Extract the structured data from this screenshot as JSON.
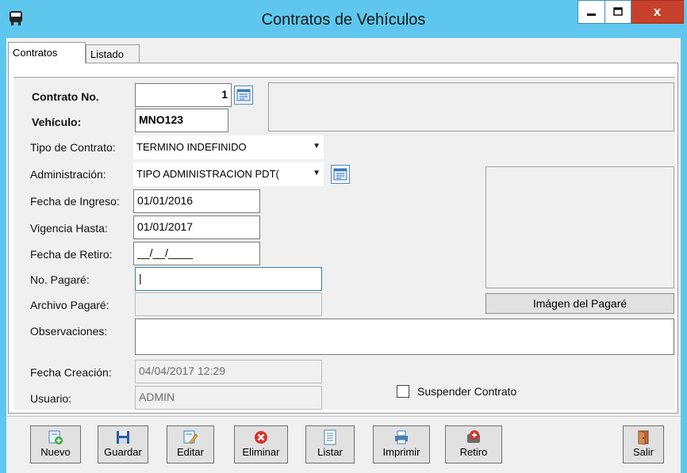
{
  "window": {
    "title": "Contratos de Vehículos",
    "close_glyph": "x"
  },
  "tabs": [
    {
      "label": "Contratos"
    },
    {
      "label": "Listado"
    }
  ],
  "form": {
    "contrato_label": "Contrato No.",
    "contrato_value": "1",
    "vehiculo_label": "Vehículo:",
    "vehiculo_value": "MNO123",
    "tipo_label": "Tipo de Contrato:",
    "tipo_value": "TERMINO INDEFINIDO",
    "admin_label": "Administración:",
    "admin_value": "TIPO ADMINISTRACION PDT(",
    "ingreso_label": "Fecha de Ingreso:",
    "ingreso_value": "01/01/2016",
    "vigencia_label": "Vigencia Hasta:",
    "vigencia_value": "01/01/2017",
    "retiro_label": "Fecha de Retiro:",
    "retiro_value": "__/__/____",
    "pagare_label": "No. Pagaré:",
    "pagare_value": "|",
    "archivo_label": "Archivo Pagaré:",
    "archivo_value": "",
    "observ_label": "Observaciones:",
    "observ_value": "",
    "creacion_label": "Fecha Creación:",
    "creacion_value": "04/04/2017 12:29",
    "usuario_label": "Usuario:",
    "usuario_value": "ADMIN",
    "imagen_button": "Imágen del Pagaré",
    "suspender_label": "Suspender Contrato",
    "suspender_checked": false
  },
  "toolbar": {
    "nuevo": "Nuevo",
    "guardar": "Guardar",
    "editar": "Editar",
    "eliminar": "Eliminar",
    "listar": "Listar",
    "imprimir": "Imprimir",
    "retiro": "Retiro",
    "salir": "Salir"
  },
  "colors": {
    "titlebar": "#5fc7ee",
    "close": "#c7402b",
    "accent": "#4a86c5"
  },
  "icons": [
    "bus-icon",
    "minimize-icon",
    "maximize-icon",
    "close-icon",
    "lookup-icon",
    "dropdown-arrow-icon",
    "new-icon",
    "save-icon",
    "edit-icon",
    "delete-icon",
    "list-icon",
    "print-icon",
    "retire-icon",
    "exit-icon"
  ]
}
